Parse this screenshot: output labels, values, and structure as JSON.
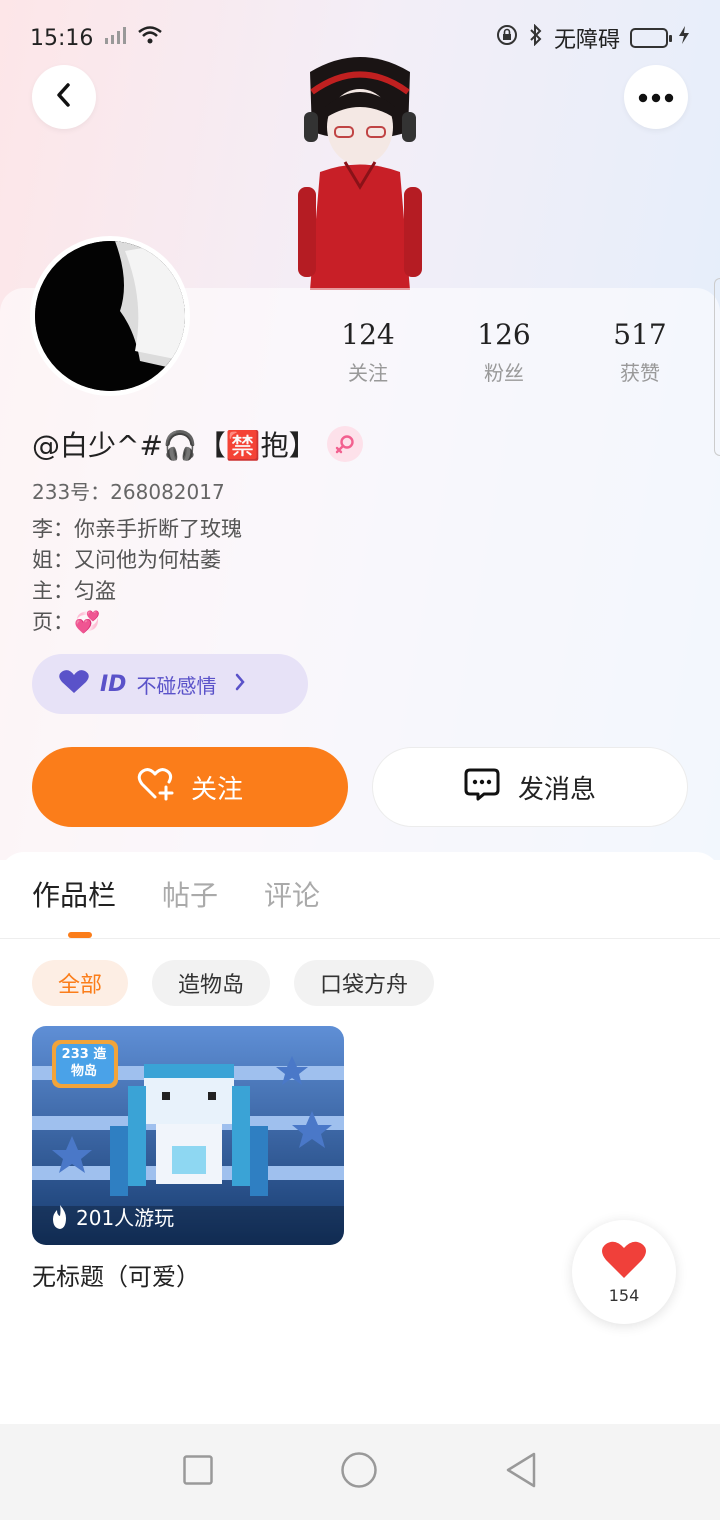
{
  "status_bar": {
    "time": "15:16",
    "accessibility_label": "无障碍"
  },
  "profile": {
    "name": "@白少^#🎧【🈲抱】",
    "uid": "233号：268082017",
    "bio_lines": [
      "李：你亲手折断了玫瑰",
      "姐：又问他为何枯萎",
      "主：匀盗",
      "页：💞"
    ],
    "stats": [
      {
        "value": "124",
        "label": "关注"
      },
      {
        "value": "126",
        "label": "粉丝"
      },
      {
        "value": "517",
        "label": "获赞"
      }
    ],
    "id_badge": {
      "prefix": "ID",
      "text": "不碰感情"
    }
  },
  "actions": {
    "follow_label": "关注",
    "message_label": "发消息"
  },
  "tabs": [
    {
      "label": "作品栏",
      "active": true
    },
    {
      "label": "帖子",
      "active": false
    },
    {
      "label": "评论",
      "active": false
    }
  ],
  "filters": [
    {
      "label": "全部",
      "active": true
    },
    {
      "label": "造物岛",
      "active": false
    },
    {
      "label": "口袋方舟",
      "active": false
    }
  ],
  "works": [
    {
      "title": "无标题（可爱）",
      "plays": "201人游玩",
      "badge": "233 造物岛"
    }
  ],
  "like_fab": {
    "count": "154"
  },
  "colors": {
    "accent": "#fb7d1a",
    "id_chip_bg": "#e7e2f7",
    "id_chip_text": "#5a52c9",
    "heart": "#f0403a"
  }
}
